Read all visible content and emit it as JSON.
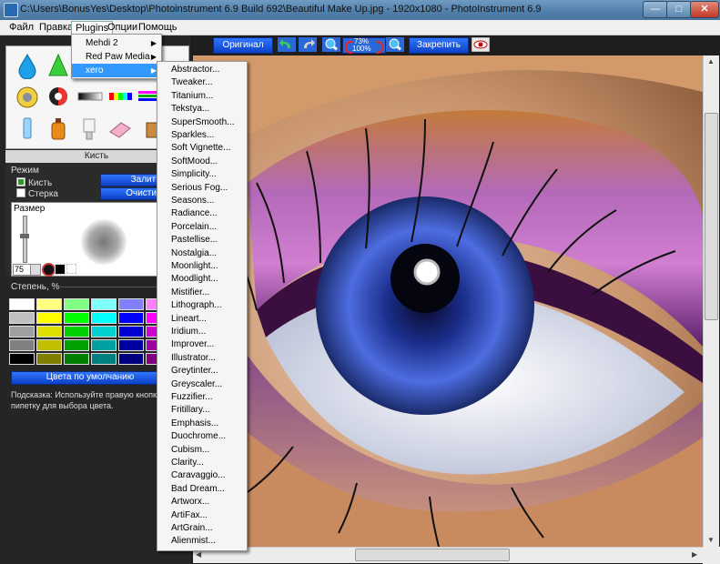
{
  "window": {
    "title": "C:\\Users\\BonusYes\\Desktop\\Photoinstrument 6.9 Build 692\\Beautiful Make Up.jpg - 1920x1080 - PhotoInstrument 6.9",
    "min": "—",
    "max": "□",
    "close": "✕"
  },
  "menu": [
    "Файл",
    "Правка",
    "Plugins",
    "Опции",
    "Помощь"
  ],
  "plugins_menu": [
    {
      "label": "Mehdi 2",
      "submenu": true
    },
    {
      "label": "Red Paw Media",
      "submenu": true
    },
    {
      "label": "xero",
      "submenu": true,
      "selected": true
    }
  ],
  "xero_menu": [
    "Abstractor...",
    "Tweaker...",
    "Titanium...",
    "Tekstya...",
    "SuperSmooth...",
    "Sparkles...",
    "Soft Vignette...",
    "SoftMood...",
    "Simplicity...",
    "Serious Fog...",
    "Seasons...",
    "Radiance...",
    "Porcelain...",
    "Pastellise...",
    "Nostalgia...",
    "Moonlight...",
    "Moodlight...",
    "Mistifier...",
    "Lithograph...",
    "Lineart...",
    "Iridium...",
    "Improver...",
    "Illustrator...",
    "Greytinter...",
    "Greyscaler...",
    "Fuzzifier...",
    "Fritillary...",
    "Emphasis...",
    "Duochrome...",
    "Cubism...",
    "Clarity...",
    "Caravaggio...",
    "Bad Dream...",
    "Artworx...",
    "ArtiFax...",
    "ArtGrain...",
    "Alienmist..."
  ],
  "toolbar": {
    "original": "Оригинал",
    "zoom_top": "73%",
    "zoom_bottom": "100%",
    "pin": "Закрепить"
  },
  "brush": {
    "header": "Кисть",
    "mode_label": "Режим",
    "mode_brush": "Кисть",
    "mode_eraser": "Стерка",
    "fill_btn": "Залить",
    "clear_btn": "Очистить",
    "size_label": "Размер",
    "size_value": "75",
    "degree_label": "Степень, %",
    "default_colors_btn": "Цвета по умолчанию",
    "hint": "Подсказка: Используйте правую кнопки пипетку для выбора цвета."
  },
  "palette_colors": [
    [
      "#ffffff",
      "#ffff80",
      "#80ff80",
      "#80ffff",
      "#8080ff",
      "#ff80ff"
    ],
    [
      "#c0c0c0",
      "#ffff00",
      "#00ff00",
      "#00ffff",
      "#0000ff",
      "#ff00ff"
    ],
    [
      "#a0a0a0",
      "#e0e000",
      "#00d000",
      "#00d0d0",
      "#0000d0",
      "#d000d0"
    ],
    [
      "#808080",
      "#c0c000",
      "#00a000",
      "#00a0a0",
      "#0000a0",
      "#a000a0"
    ],
    [
      "#000000",
      "#808000",
      "#008000",
      "#008080",
      "#000080",
      "#800080"
    ]
  ],
  "icons": {
    "tools": [
      "water-drop-icon",
      "cone-icon",
      "tool-3-icon",
      "tool-4-icon",
      "stamp-icon",
      "contrast-icon",
      "gradient-icon",
      "color-bars-icon",
      "color-lines-icon",
      "tool-10-icon",
      "tube-icon",
      "bottle-icon",
      "lamp-icon",
      "eraser-icon",
      "tool-15-icon"
    ]
  }
}
